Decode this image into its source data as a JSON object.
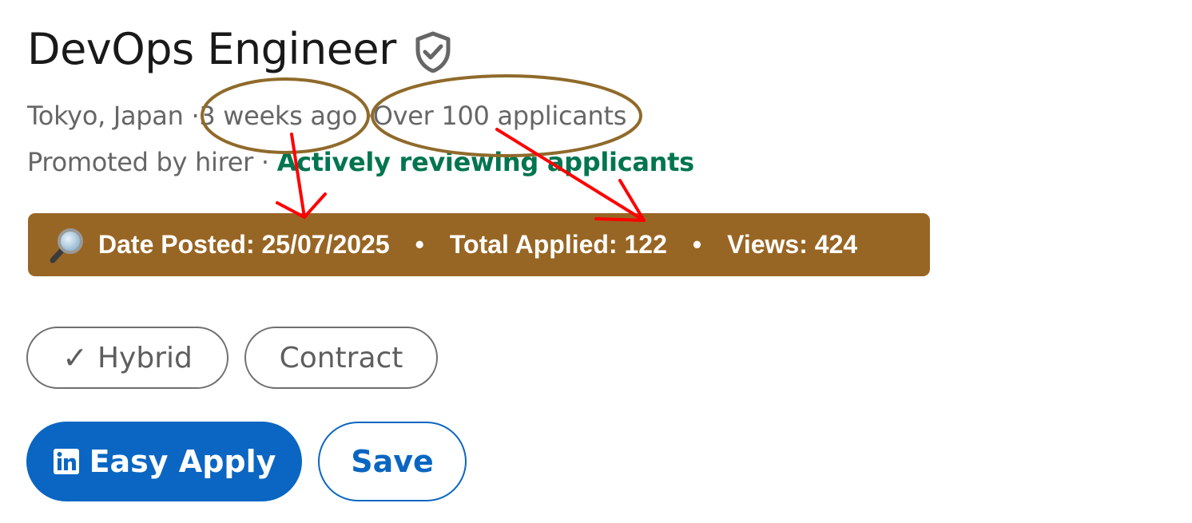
{
  "job": {
    "title": "DevOps Engineer",
    "verified_icon": "shield-check-icon",
    "location": "Tokyo, Japan",
    "separator": "·",
    "posted": "3 weeks ago",
    "applicants": "Over 100 applicants",
    "promoted": "Promoted by hirer",
    "status": "Actively reviewing applicants"
  },
  "banner": {
    "icon": "magnifier-icon",
    "date_posted": "Date Posted: 25/07/2025",
    "total_applied": "Total Applied: 122",
    "views": "Views: 424",
    "separator": "•",
    "color": "#986624"
  },
  "tags": [
    {
      "check": "✓",
      "label": "Hybrid"
    },
    {
      "label": "Contract"
    }
  ],
  "actions": {
    "apply_label": "Easy Apply",
    "apply_icon": "linkedin-icon",
    "save_label": "Save",
    "accent": "#0a66c2"
  },
  "annotation_colors": {
    "ellipse": "#8f6a2a",
    "arrow": "#ff0000"
  }
}
